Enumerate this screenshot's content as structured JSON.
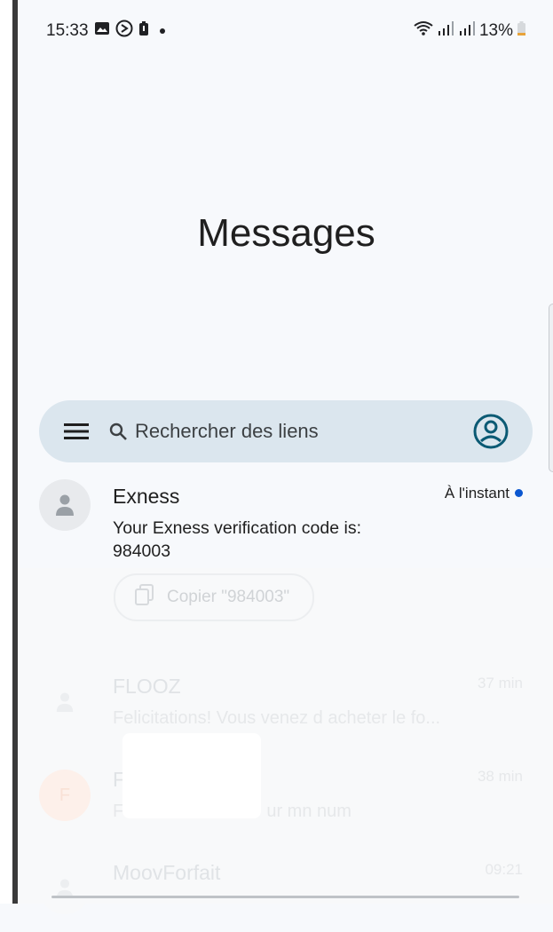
{
  "status_bar": {
    "time": "15:33",
    "battery": "13%",
    "icons": [
      "gallery-icon",
      "media-icon",
      "battery-saver-icon",
      "wifi-icon",
      "signal-icon",
      "signal-icon",
      "battery-icon"
    ]
  },
  "title": "Messages",
  "search": {
    "placeholder": "Rechercher des liens"
  },
  "conversations": [
    {
      "name": "Exness",
      "time": "À l'instant",
      "snippet": "Your Exness verification code is: 984003",
      "unread": true
    },
    {
      "name": "FLOOZ",
      "time": "37 min",
      "snippet": "Felicitations! Vous venez d acheter le fo..."
    },
    {
      "name": "F",
      "time": "38 min",
      "snippet_start": "F",
      "snippet_end": "ur mn num"
    },
    {
      "name": "MoovForfait",
      "time": "09:21"
    }
  ],
  "copy_chip": {
    "label": "Copier \"984003\""
  },
  "colors": {
    "search_bg": "#dbe6ee",
    "accent": "#0b57d0",
    "account_icon": "#0b5a74"
  }
}
